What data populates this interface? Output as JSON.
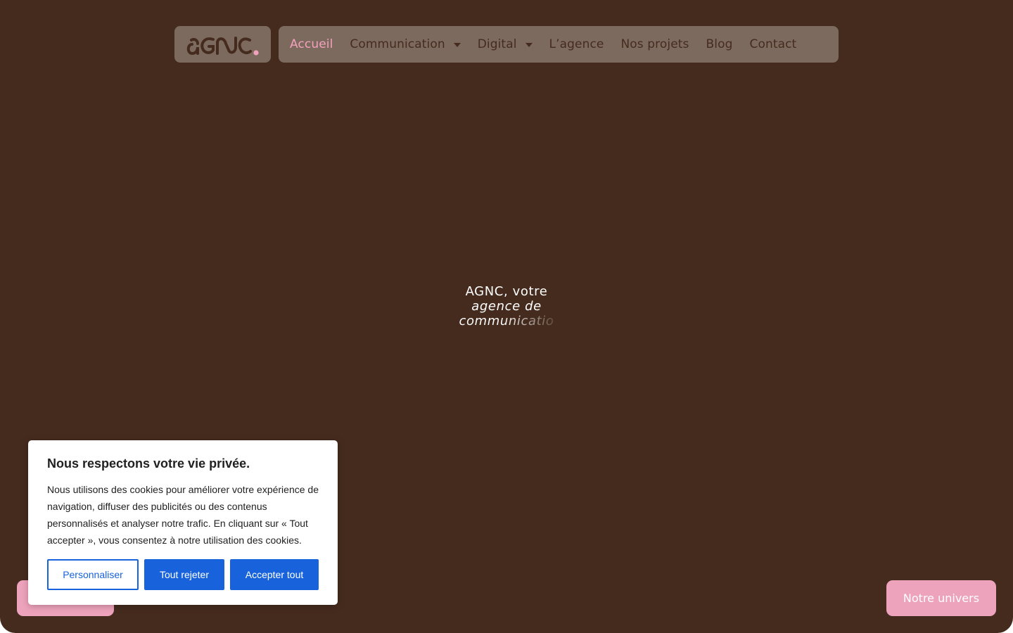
{
  "header": {
    "logo_text": "agnc.",
    "nav": [
      {
        "label": "Accueil",
        "active": true,
        "has_dropdown": false
      },
      {
        "label": "Communication",
        "active": false,
        "has_dropdown": true
      },
      {
        "label": "Digital",
        "active": false,
        "has_dropdown": true
      },
      {
        "label": "L’agence",
        "active": false,
        "has_dropdown": false
      },
      {
        "label": "Nos projets",
        "active": false,
        "has_dropdown": false
      },
      {
        "label": "Blog",
        "active": false,
        "has_dropdown": false
      },
      {
        "label": "Contact",
        "active": false,
        "has_dropdown": false
      }
    ]
  },
  "hero": {
    "line1": "AGNC, votre",
    "line2": "agence de",
    "line3": "communicatio"
  },
  "cookie_banner": {
    "title": "Nous respectons votre vie privée.",
    "text": "Nous utilisons des cookies pour améliorer votre expérience de navigation, diffuser des publicités ou des contenus personnalisés et analyser notre trafic. En cliquant sur « Tout accepter », vous consentez à notre utilisation des cookies.",
    "customize_label": "Personnaliser",
    "reject_label": "Tout rejeter",
    "accept_label": "Accepter tout"
  },
  "floating_buttons": {
    "univers_label": "Notre univers"
  },
  "colors": {
    "background": "#452b1e",
    "nav_background": "#7d6a5f",
    "accent_pink": "#eea3bd",
    "cookie_blue": "#1863dc"
  },
  "icons": {
    "dropdown": "caret-down-icon",
    "logo_dot": "pink-dot"
  }
}
